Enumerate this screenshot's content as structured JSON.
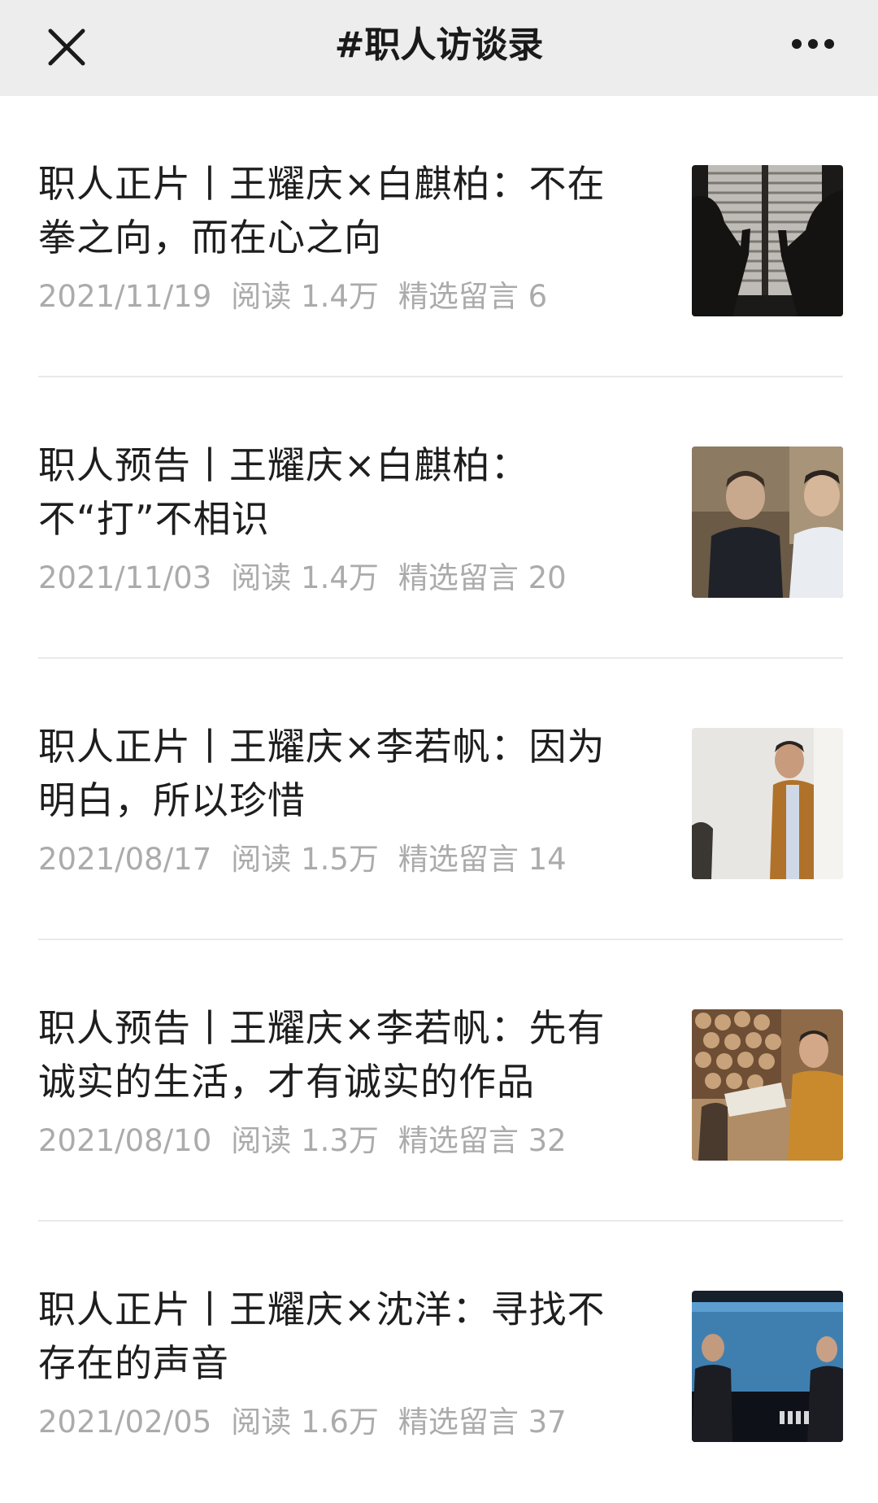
{
  "header": {
    "title": "#职人访谈录",
    "close_icon": "close-icon",
    "more_icon": "more-icon"
  },
  "articles": [
    {
      "title": "职人正片丨王耀庆×白麒柏：不在拳之向，而在心之向",
      "date": "2021/11/19",
      "reads": "阅读 1.4万",
      "comments": "精选留言 6",
      "thumb": "thumbnail-silhouettes-window"
    },
    {
      "title": "职人预告丨王耀庆×白麒柏：不“打”不相识",
      "date": "2021/11/03",
      "reads": "阅读 1.4万",
      "comments": "精选留言 20",
      "thumb": "thumbnail-two-men-laughing"
    },
    {
      "title": "职人正片丨王耀庆×李若帆：因为明白，所以珍惜",
      "date": "2021/08/17",
      "reads": "阅读 1.5万",
      "comments": "精选留言 14",
      "thumb": "thumbnail-man-peeking-wall"
    },
    {
      "title": "职人预告丨王耀庆×李若帆：先有诚实的生活，才有诚实的作品",
      "date": "2021/08/10",
      "reads": "阅读 1.3万",
      "comments": "精选留言 32",
      "thumb": "thumbnail-woodpile-reading"
    },
    {
      "title": "职人正片丨王耀庆×沈洋：寻找不存在的声音",
      "date": "2021/02/05",
      "reads": "阅读 1.6万",
      "comments": "精选留言 37",
      "thumb": "thumbnail-stage-performers"
    }
  ]
}
